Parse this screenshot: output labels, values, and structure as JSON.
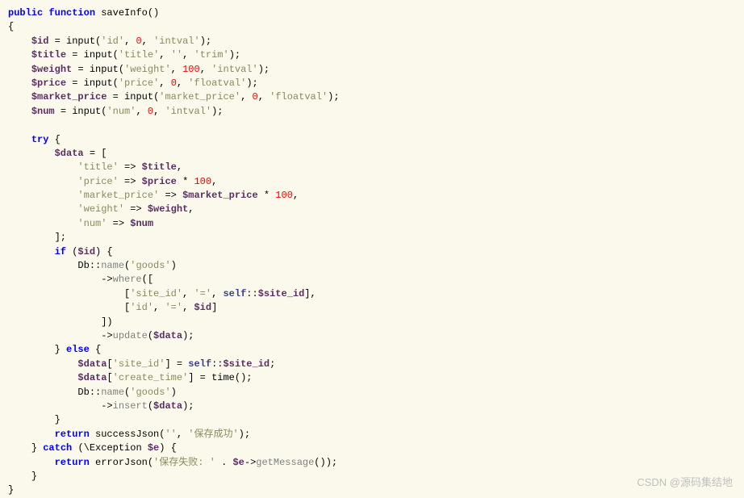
{
  "code": {
    "l1": {
      "kw1": "public",
      "kw2": "function",
      "name": "saveInfo"
    },
    "l3": {
      "v": "$id",
      "call": "input",
      "a1": "'id'",
      "n": "0",
      "a3": "'intval'"
    },
    "l4": {
      "v": "$title",
      "call": "input",
      "a1": "'title'",
      "a2": "''",
      "a3": "'trim'"
    },
    "l5": {
      "v": "$weight",
      "call": "input",
      "a1": "'weight'",
      "n": "100",
      "a3": "'intval'"
    },
    "l6": {
      "v": "$price",
      "call": "input",
      "a1": "'price'",
      "n": "0",
      "a3": "'floatval'"
    },
    "l7": {
      "v": "$market_price",
      "call": "input",
      "a1": "'market_price'",
      "n": "0",
      "a3": "'floatval'"
    },
    "l8": {
      "v": "$num",
      "call": "input",
      "a1": "'num'",
      "n": "0",
      "a3": "'intval'"
    },
    "l10": {
      "kw": "try"
    },
    "l11": {
      "v": "$data"
    },
    "l12": {
      "k": "'title'",
      "v": "$title"
    },
    "l13": {
      "k": "'price'",
      "v": "$price",
      "n": "100"
    },
    "l14": {
      "k": "'market_price'",
      "v": "$market_price",
      "n": "100"
    },
    "l15": {
      "k": "'weight'",
      "v": "$weight"
    },
    "l16": {
      "k": "'num'",
      "v": "$num"
    },
    "l18": {
      "kw": "if",
      "v": "$id"
    },
    "l19": {
      "cls": "Db",
      "m": "name",
      "a": "'goods'"
    },
    "l20": {
      "m": "where"
    },
    "l21": {
      "k": "'site_id'",
      "op": "'='",
      "self": "self",
      "prop": "$site_id"
    },
    "l22": {
      "k": "'id'",
      "op": "'='",
      "v": "$id"
    },
    "l24": {
      "m": "update",
      "v": "$data"
    },
    "l25": {
      "kw": "else"
    },
    "l26": {
      "v": "$data",
      "k": "'site_id'",
      "self": "self",
      "prop": "$site_id"
    },
    "l27": {
      "v": "$data",
      "k": "'create_time'",
      "fn": "time"
    },
    "l28": {
      "cls": "Db",
      "m": "name",
      "a": "'goods'"
    },
    "l29": {
      "m": "insert",
      "v": "$data"
    },
    "l31": {
      "kw": "return",
      "fn": "successJson",
      "a1": "''",
      "a2": "'保存成功'"
    },
    "l32": {
      "kw": "catch",
      "cls": "Exception",
      "v": "$e"
    },
    "l33": {
      "kw": "return",
      "fn": "errorJson",
      "a1": "'保存失败: '",
      "v": "$e",
      "m": "getMessage"
    }
  },
  "watermark": "CSDN @源码集结地"
}
